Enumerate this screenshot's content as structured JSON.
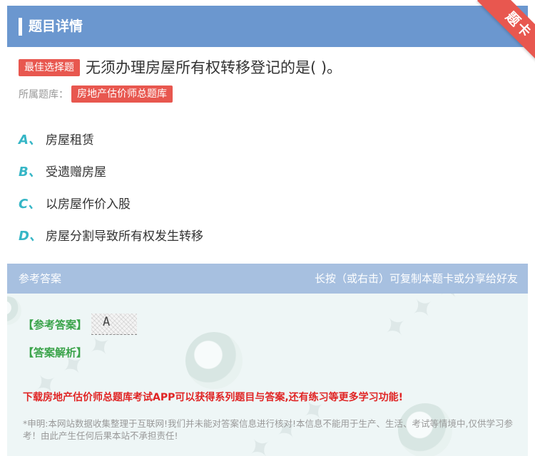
{
  "header": {
    "title": "题目详情",
    "ribbon": "题卡"
  },
  "question": {
    "type_tag": "最佳选择题",
    "text": "无须办理房屋所有权转移登记的是( )。",
    "bank_label": "所属题库：",
    "bank_name": "房地产估价师总题库"
  },
  "options": [
    {
      "letter": "A、",
      "text": "房屋租赁"
    },
    {
      "letter": "B、",
      "text": "受遗赠房屋"
    },
    {
      "letter": "C、",
      "text": "以房屋作价入股"
    },
    {
      "letter": "D、",
      "text": "房屋分割导致所有权发生转移"
    }
  ],
  "answer": {
    "head_left": "参考答案",
    "head_right": "长按（或右击）可复制本题卡或分享给好友",
    "ref_label": "【参考答案】",
    "ref_value": "A",
    "analysis_label": "【答案解析】",
    "download_text": "下载房地产估价师总题库考试APP可以获得系列题目与答案,还有练习等更多学习功能!",
    "disclaimer": "*申明:本网站数据收集整理于互联网!我们并未能对答案信息进行核对!本信息不能用于生产、生活、考试等情境中,仅供学习参考！由此产生任何后果本站不承担责任!"
  },
  "colors": {
    "header_bg": "#6b97cf",
    "accent_red": "#e8574f",
    "option_letter": "#36b6c6",
    "answer_green": "#3aa34a",
    "download_red": "#e02424"
  }
}
